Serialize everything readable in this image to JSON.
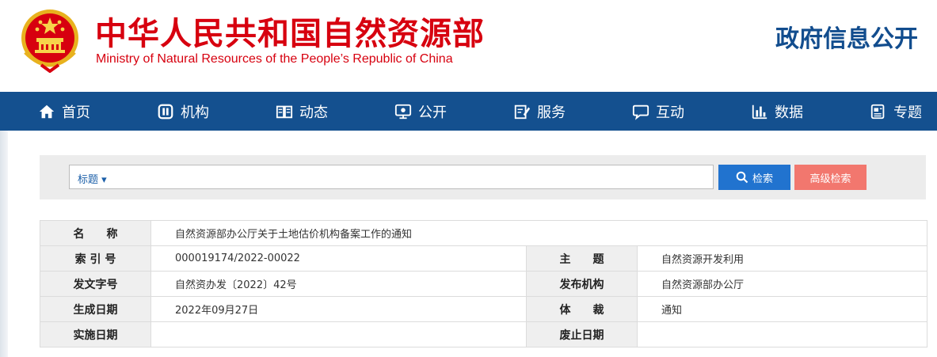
{
  "header": {
    "title_cn": "中华人民共和国自然资源部",
    "title_en": "Ministry of Natural Resources of the People’s Republic of China",
    "right_title": "政府信息公开",
    "emblem_icon": "national-emblem-icon"
  },
  "nav": {
    "items": [
      {
        "label": "首页",
        "icon": "home-icon"
      },
      {
        "label": "机构",
        "icon": "org-icon"
      },
      {
        "label": "动态",
        "icon": "book-icon"
      },
      {
        "label": "公开",
        "icon": "monitor-icon"
      },
      {
        "label": "服务",
        "icon": "edit-icon"
      },
      {
        "label": "互动",
        "icon": "chat-icon"
      },
      {
        "label": "数据",
        "icon": "bar-chart-icon"
      },
      {
        "label": "专题",
        "icon": "document-icon"
      }
    ]
  },
  "search": {
    "select_label": "标题",
    "search_label": "检索",
    "advanced_label": "高级检索",
    "input_value": ""
  },
  "info": {
    "name_label": "名　　称",
    "name_value": "自然资源部办公厅关于土地估价机构备案工作的通知",
    "index_label": "索 引 号",
    "index_value": "000019174/2022-00022",
    "subject_label": "主　　题",
    "subject_value": "自然资源开发利用",
    "docno_label": "发文字号",
    "docno_value": "自然资办发〔2022〕42号",
    "publisher_label": "发布机构",
    "publisher_value": "自然资源部办公厅",
    "created_label": "生成日期",
    "created_value": "2022年09月27日",
    "genre_label": "体　　裁",
    "genre_value": "通知",
    "effective_label": "实施日期",
    "effective_value": "",
    "expiry_label": "废止日期",
    "expiry_value": ""
  },
  "colors": {
    "brand_red": "#d7000f",
    "nav_blue": "#14508f",
    "search_blue": "#2173cf",
    "advanced_red": "#f2776e"
  }
}
